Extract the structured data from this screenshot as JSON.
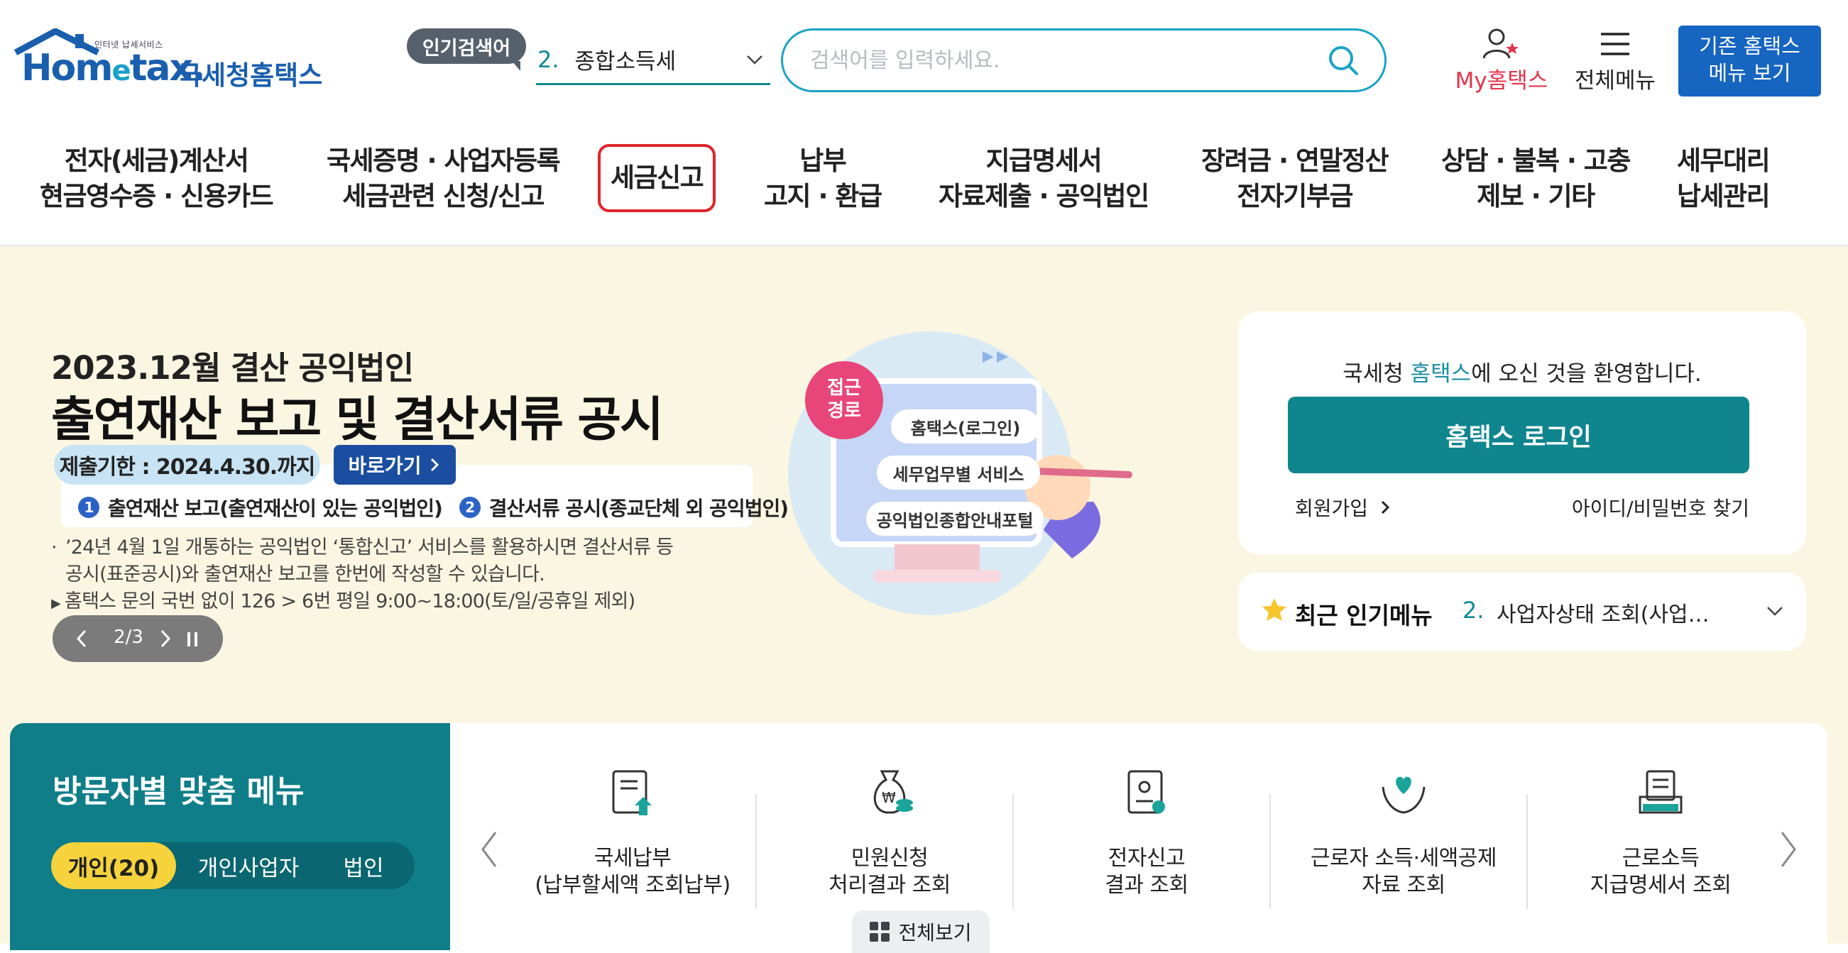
{
  "header": {
    "logo_tagline": "인터넷 납세서비스",
    "logo_word_left": "Hom",
    "logo_word_e": "e",
    "logo_word_right": "tax.",
    "logo_kr": "국세청홈택스",
    "popular_search_label": "인기검색어",
    "popular_rank": "2.",
    "popular_term": "종합소득세",
    "search_placeholder": "검색어를 입력하세요.",
    "my_hometax": "My홈택스",
    "all_menu": "전체메뉴",
    "old_menu_line1": "기존 홈택스",
    "old_menu_line2": "메뉴 보기"
  },
  "gnb": [
    {
      "line1": "전자(세금)계산서",
      "line2": "현금영수증 · 신용카드"
    },
    {
      "line1": "국세증명 · 사업자등록",
      "line2": "세금관련 신청/신고"
    },
    {
      "line1": "세금신고",
      "line2": ""
    },
    {
      "line1": "납부",
      "line2": "고지 · 환급"
    },
    {
      "line1": "지급명세서",
      "line2": "자료제출 · 공익법인"
    },
    {
      "line1": "장려금 · 연말정산",
      "line2": "전자기부금"
    },
    {
      "line1": "상담 · 불복 · 고충",
      "line2": "제보 · 기타"
    },
    {
      "line1": "세무대리",
      "line2": "납세관리"
    }
  ],
  "banner": {
    "small_title": "2023.12월 결산 공익법인",
    "title": "출연재산 보고 및 결산서류 공시",
    "deadline": "제출기한 : 2024.4.30.까지",
    "go_button": "바로가기",
    "item1_num": "1",
    "item1": "출연재산 보고(출연재산이 있는 공익법인)",
    "item2_num": "2",
    "item2": "결산서류 공시(종교단체 외 공익법인)",
    "note1_line1": "’24년 4월 1일 개통하는 공익법인 ‘통합신고’ 서비스를 활용하시면 결산서류 등",
    "note1_line2": "공시(표준공시)와 출연재산 보고를 한번에 작성할 수 있습니다.",
    "note2": "홈택스 문의 국번 없이 126 > 6번 평일 9:00~18:00(토/일/공휴일 제외)",
    "pager_count": "2/3",
    "illust_badge_line1": "접근",
    "illust_badge_line2": "경로",
    "illust_step1": "홈택스(로그인)",
    "illust_step2": "세무업무별 서비스",
    "illust_step3": "공익법인종합안내포털"
  },
  "login": {
    "welcome_prefix": "국세청 ",
    "welcome_highlight": "홈택스",
    "welcome_suffix": "에 오신 것을 환영합니다.",
    "login_button": "홈택스 로그인",
    "signup": "회원가입",
    "find_id": "아이디/비밀번호 찾기"
  },
  "recent": {
    "title": "최근 인기메뉴",
    "rank": "2.",
    "term": "사업자상태 조회(사업…"
  },
  "visitor": {
    "title": "방문자별 맞춤 메뉴",
    "tabs": [
      "개인(20)",
      "개인사업자",
      "법인"
    ]
  },
  "quick_menu": [
    {
      "icon": "tax-payment-icon",
      "line1": "국세납부",
      "line2": "(납부할세액 조회납부)"
    },
    {
      "icon": "won-bag-icon",
      "line1": "민원신청",
      "line2": "처리결과 조회"
    },
    {
      "icon": "certificate-icon",
      "line1": "전자신고",
      "line2": "결과 조회"
    },
    {
      "icon": "heart-hands-icon",
      "line1": "근로자 소득·세액공제",
      "line2": "자료 조회"
    },
    {
      "icon": "document-tray-icon",
      "line1": "근로소득",
      "line2": "지급명세서 조회"
    }
  ],
  "see_all": "전체보기",
  "colors": {
    "brand_blue": "#1a5fae",
    "teal": "#0f858e",
    "hero_bg": "#fbf6e2",
    "active_border": "#e0242a",
    "accent_yellow": "#f6d33c",
    "my_red": "#e3344b"
  }
}
